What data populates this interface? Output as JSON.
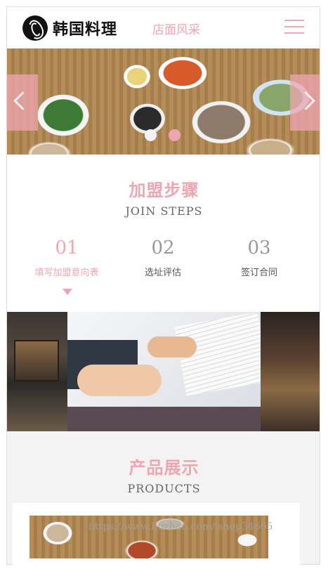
{
  "header": {
    "logo_text": "韩国料理",
    "nav_title": "店面风采",
    "menu_icon": "hamburger-menu-icon"
  },
  "banner": {
    "slides": 2,
    "active_slide": 2,
    "prev_icon": "chevron-left-icon",
    "next_icon": "chevron-right-icon"
  },
  "join_steps": {
    "title": "加盟步骤",
    "subtitle": "JOIN STEPS",
    "steps": [
      {
        "num": "01",
        "label": "填写加盟意向表",
        "active": true
      },
      {
        "num": "02",
        "label": "选址评估",
        "active": false
      },
      {
        "num": "03",
        "label": "签订合同",
        "active": false
      }
    ]
  },
  "products": {
    "title": "产品展示",
    "subtitle": "PRODUCTS"
  },
  "watermark": "https://www.huzhan.com/ishop34665",
  "colors": {
    "accent": "#f0a5b3",
    "muted_text": "#666666",
    "section_bg": "#f3f3f3"
  }
}
